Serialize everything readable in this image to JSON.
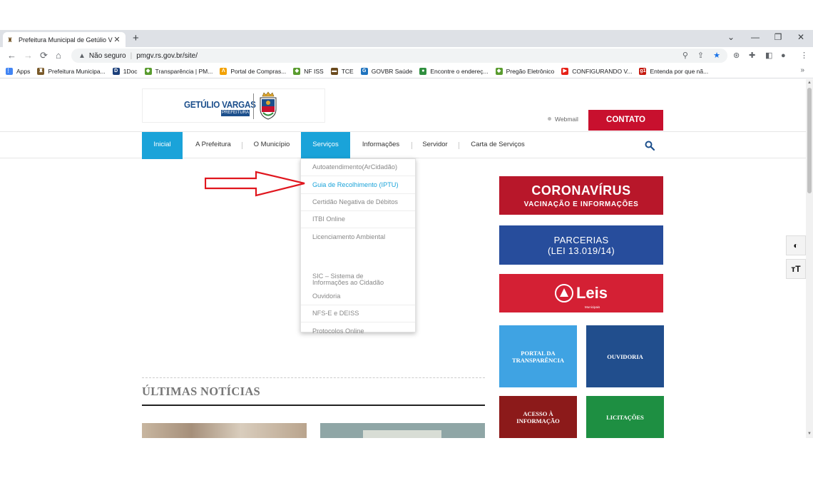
{
  "browser": {
    "tab_title": "Prefeitura Municipal de Getúlio V",
    "tab_close": "✕",
    "new_tab": "+",
    "window_controls": [
      "⌄",
      "—",
      "❐",
      "✕"
    ],
    "security_label": "Não seguro",
    "url": "pmgv.rs.gov.br/site/",
    "bookmarks": [
      {
        "label": "Apps",
        "icon": "apps-grid-icon",
        "color": "#4285f4"
      },
      {
        "label": "Prefeitura Municipa...",
        "icon": "crest-favicon",
        "color": "#7a5a2a"
      },
      {
        "label": "1Doc",
        "icon": "1doc-icon",
        "color": "#1b3f7a"
      },
      {
        "label": "Transparência | PM...",
        "icon": "diamond-icon",
        "color": "#5a9c2f"
      },
      {
        "label": "Portal de Compras...",
        "icon": "lambda-icon",
        "color": "#f2a100"
      },
      {
        "label": "NF ISS",
        "icon": "diamond-icon",
        "color": "#5a9c2f"
      },
      {
        "label": "TCE",
        "icon": "tce-icon",
        "color": "#6b4b1e"
      },
      {
        "label": "GOVBR Saúde",
        "icon": "govbr-icon",
        "color": "#1e73be"
      },
      {
        "label": "Encontre o endereç...",
        "icon": "globe-icon",
        "color": "#2f8f3f"
      },
      {
        "label": "Pregão Eletrônico",
        "icon": "diamond-icon",
        "color": "#5a9c2f"
      },
      {
        "label": "CONFIGURANDO V...",
        "icon": "youtube-icon",
        "color": "#e62117"
      },
      {
        "label": "Entenda por que nã...",
        "icon": "g1-icon",
        "color": "#c4170c"
      }
    ],
    "bookmarks_more": "»"
  },
  "header": {
    "logo_title": "GETÚLIO VARGAS",
    "logo_subtitle": "PREFEITURA",
    "webmail": "Webmail",
    "contato": "CONTATO"
  },
  "nav": {
    "items": [
      "Inicial",
      "A Prefeitura",
      "O Município",
      "Serviços",
      "Informações",
      "Servidor",
      "Carta de Serviços"
    ]
  },
  "dropdown": {
    "items": [
      "Autoatendimento(ArCidadão)",
      "Guia de Recolhimento (IPTU)",
      "Certidão Negativa de Débitos",
      "ITBI Online",
      "Licenciamento Ambiental",
      "SIC – Sistema de",
      "Informações ao Cidadão",
      "Ouvidoria",
      "NFS-E e DEISS",
      "Protocolos Online"
    ]
  },
  "banners": {
    "corona_title": "CORONAVÍRUS",
    "corona_subtitle": "VACINAÇÃO E INFORMAÇÕES",
    "parcerias_line1": "PARCERIAS",
    "parcerias_line2": "(LEI 13.019/14)",
    "leis_title": "Leis",
    "leis_subtitle": "Municipais"
  },
  "tiles": {
    "portal_line1": "PORTAL DA",
    "portal_line2": "TRANSPARÊNCIA",
    "ouvidoria": "OUVIDORIA",
    "acesso_line1": "ACESSO À",
    "acesso_line2": "INFORMAÇÃO",
    "licitacoes": "LICITAÇÕES"
  },
  "news": {
    "title": "ÚLTIMAS NOTÍCIAS"
  },
  "accessibility": {
    "contrast_icon": "◐",
    "font_size_icon": "тT"
  },
  "colors": {
    "nav_active": "#1aa3d9",
    "contato": "#c8102e",
    "corona": "#b8172a",
    "parcerias": "#274d9c",
    "leis": "#d42034"
  }
}
